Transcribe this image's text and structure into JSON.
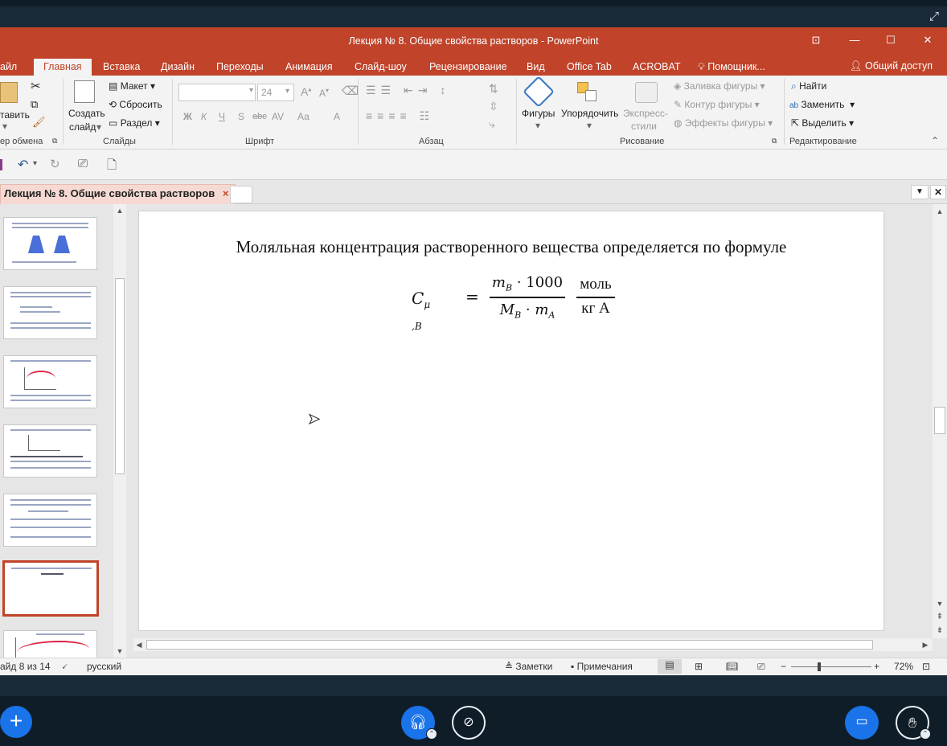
{
  "window": {
    "title": "Лекция № 8. Общие свойства растворов - PowerPoint"
  },
  "ribbon_tabs": [
    "айл",
    "Главная",
    "Вставка",
    "Дизайн",
    "Переходы",
    "Анимация",
    "Слайд-шоу",
    "Рецензирование",
    "Вид",
    "Office Tab",
    "ACROBAT",
    "Помощник..."
  ],
  "share_label": "Общий доступ",
  "ribbon": {
    "clipboard": {
      "paste": "тавить",
      "label": "ер обмена"
    },
    "slides": {
      "create": "Создать",
      "slide": "слайд",
      "layout": "Макет",
      "reset": "Сбросить",
      "section": "Раздел",
      "label": "Слайды"
    },
    "font": {
      "size": "24",
      "label": "Шрифт",
      "bold": "Ж",
      "italic": "К",
      "underline": "Ч",
      "shadow": "S",
      "strike": "abc",
      "spacing": "AV",
      "case": "Аа",
      "color": "А"
    },
    "paragraph": {
      "label": "Абзац"
    },
    "drawing": {
      "shapes": "Фигуры",
      "arrange": "Упорядочить",
      "express1": "Экспресс-",
      "express2": "стили",
      "fill": "Заливка фигуры",
      "outline": "Контур фигуры",
      "effects": "Эффекты фигуры",
      "label": "Рисование"
    },
    "editing": {
      "find": "Найти",
      "replace": "Заменить",
      "select": "Выделить",
      "label": "Редактирование"
    }
  },
  "doc_tab": {
    "label": "Лекция № 8. Общие свойства растворов",
    "close": "×"
  },
  "slide": {
    "heading": "Моляльная концентрация растворенного вещества определяется по формуле",
    "formula": {
      "lhs_symbol": "C",
      "lhs_sub": "μ ,B",
      "equals": "=",
      "num_m": "m",
      "num_sub": "B",
      "num_rest": " · 1000",
      "den_m": "M",
      "den_sub1": "B",
      "den_mid": " · m",
      "den_sub2": "A",
      "unit_num": "моль",
      "unit_den": "кг А"
    }
  },
  "status": {
    "slide_info": "айд 8 из 14",
    "language": "русский",
    "notes": "Заметки",
    "comments": "Примечания",
    "zoom": "72%"
  },
  "colors": {
    "accent": "#c0432a",
    "conference_bg": "#0f1d29",
    "blue_button": "#1a73e8"
  }
}
